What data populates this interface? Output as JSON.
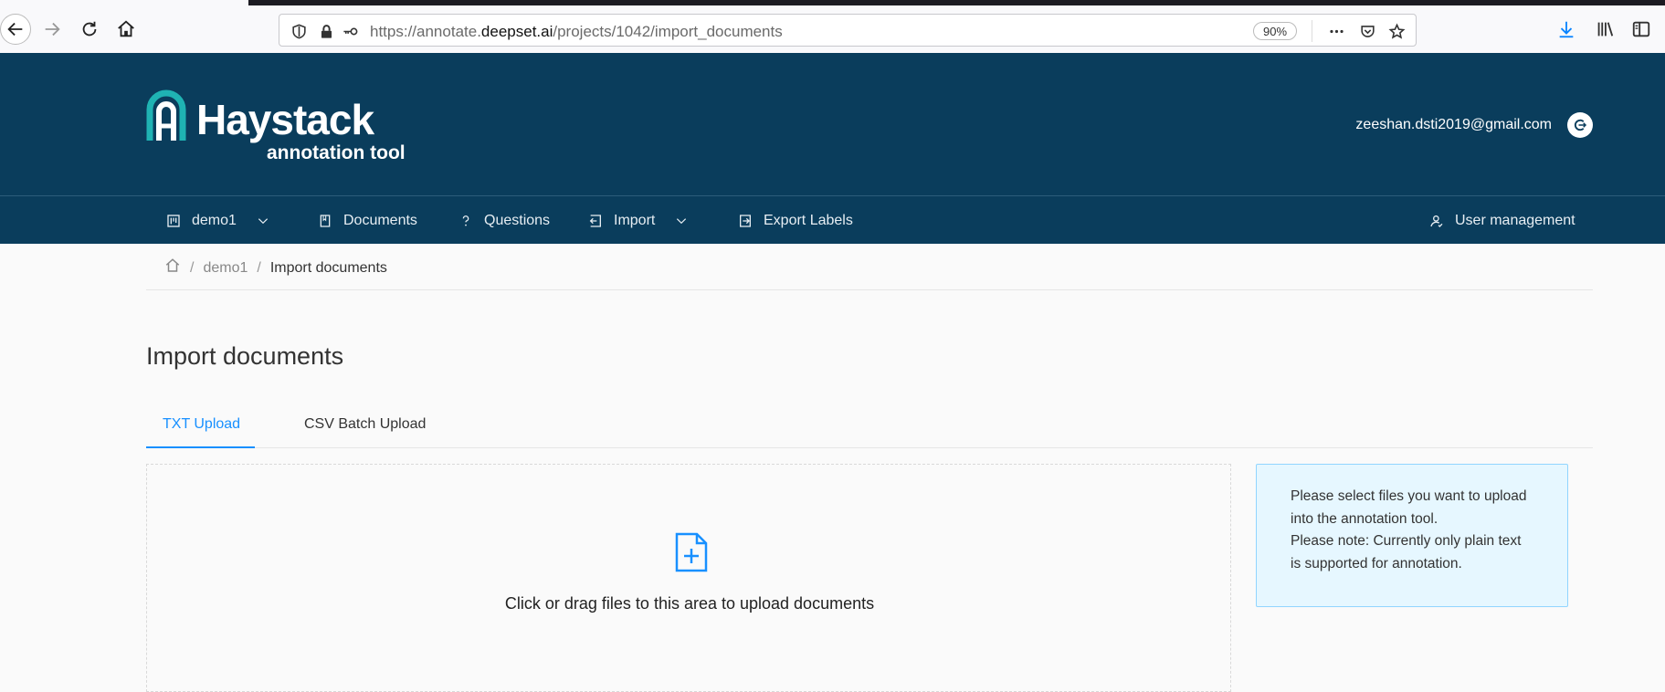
{
  "browser": {
    "url_prefix": "https://annotate.",
    "url_domain": "deepset.ai",
    "url_path": "/projects/1042/import_documents",
    "zoom": "90%"
  },
  "header": {
    "logo_title": "Haystack",
    "logo_subtitle": "annotation tool",
    "user_email": "zeeshan.dsti2019@gmail.com"
  },
  "nav": {
    "project": "demo1",
    "documents": "Documents",
    "questions": "Questions",
    "import": "Import",
    "export": "Export Labels",
    "user_management": "User management"
  },
  "breadcrumb": {
    "project": "demo1",
    "current": "Import documents",
    "sep": "/"
  },
  "page": {
    "title": "Import documents",
    "tabs": [
      "TXT Upload",
      "CSV Batch Upload"
    ],
    "dropzone_text": "Click or drag files to this area to upload documents",
    "info_lines": [
      "Please select files you want to upload",
      "into the annotation tool.",
      "Please note: Currently only plain text",
      "is supported for annotation."
    ]
  },
  "colors": {
    "header_bg": "#0a3d5c",
    "accent": "#1890ff",
    "info_bg": "#e6f7ff"
  }
}
